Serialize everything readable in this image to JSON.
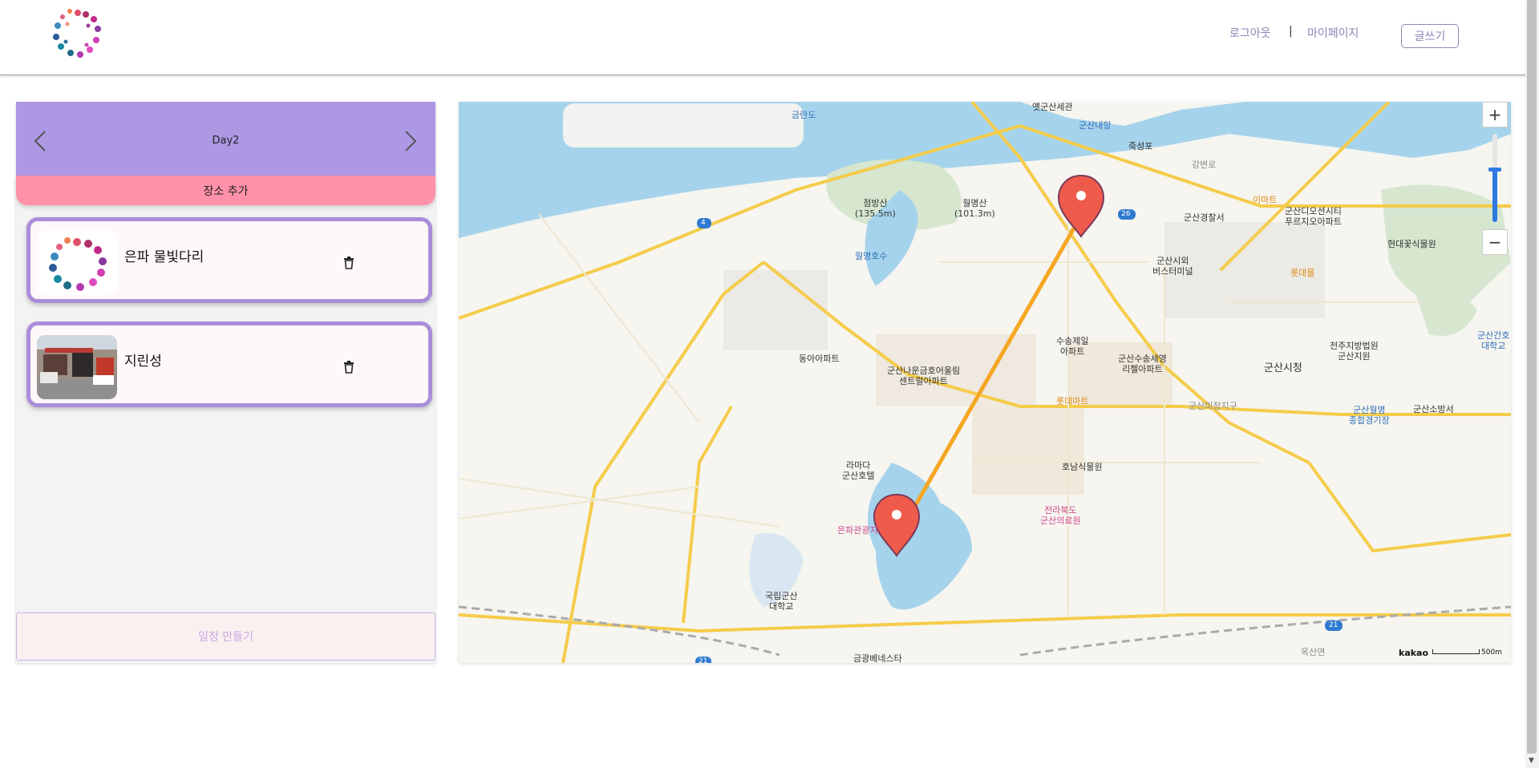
{
  "header": {
    "logout": "로그아웃",
    "separator": "|",
    "mypage": "마이페이지",
    "write": "글쓰기"
  },
  "planner": {
    "day": "Day2",
    "add_place": "장소 추가",
    "places": [
      {
        "name": "은파 물빛다리"
      },
      {
        "name": "지린성"
      }
    ],
    "make_schedule": "일정 만들기"
  },
  "map": {
    "labels": [
      "금란도",
      "옛군산세관",
      "군산내항",
      "죽성포",
      "강변로",
      "점방산\n(135.5m)",
      "월명산\n(101.3m)",
      "월명호수",
      "군산경찰서",
      "이마트",
      "군산디오션시티\n푸르지오아파트",
      "현대꽃식물원",
      "군산시외\n버스터미널",
      "롯데몰",
      "동아아파트",
      "군산나운금호어울림\n센트럴아파트",
      "수송제일\n아파트",
      "군산수송세영\n리첼아파트",
      "롯데마트",
      "군산미장지구",
      "군산시청",
      "전주지방법원\n군산지원",
      "군산간호\n대학교",
      "군산월명\n종합경기장",
      "군산소방서",
      "라마다\n군산호텔",
      "호남식물원",
      "전라북도\n군산의료원",
      "은파관광지",
      "국립군산\n대학교",
      "금광베네스타",
      "옥산면"
    ],
    "route_badges": [
      "4",
      "26",
      "21",
      "21"
    ],
    "attribution": "kakao",
    "scale": "500m"
  },
  "colors": {
    "day_header": "#ad98e4",
    "add_place": "#ff91a8",
    "card_border": "#a98ed9",
    "route": "#f5a623",
    "marker": "#ef5b4b"
  }
}
